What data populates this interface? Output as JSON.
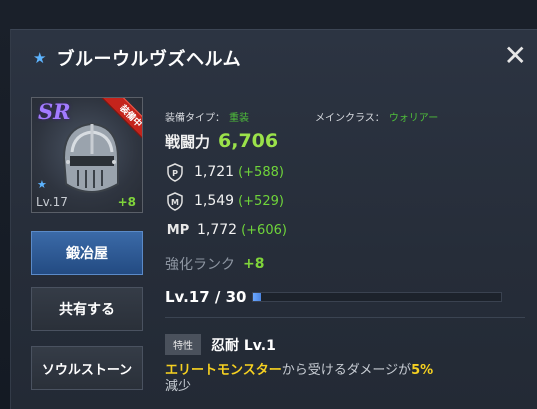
{
  "item": {
    "name": "ブルーウルヴズヘルム",
    "rarity": "SR",
    "equipped_badge": "装備中",
    "card_level": "Lv.17",
    "card_plus": "+8"
  },
  "buttons": {
    "smith": "鍛冶屋",
    "share": "共有する",
    "soulstone": "ソウルストーン"
  },
  "meta": {
    "equip_type_label": "装備タイプ：",
    "equip_type_value": "重装",
    "main_class_label": "メインクラス：",
    "main_class_value": "ウォリアー"
  },
  "power": {
    "label": "戦闘力",
    "value": "6,706"
  },
  "stats": [
    {
      "icon": "p-shield-icon",
      "value": "1,721",
      "bonus": "(+588)"
    },
    {
      "icon": "m-shield-icon",
      "value": "1,549",
      "bonus": "(+529)"
    },
    {
      "icon": "mp-icon",
      "label": "MP",
      "value": "1,772",
      "bonus": "(+606)"
    }
  ],
  "enhance": {
    "label": "強化ランク",
    "value": "+8"
  },
  "level": {
    "text": "Lv.17 / 30",
    "current": 17,
    "max": 30
  },
  "trait": {
    "tag": "特性",
    "name": "忍耐 Lv.1",
    "desc_target": "エリートモンスター",
    "desc_mid": "から受けるダメージが",
    "desc_pct": "5%",
    "desc_end": "減少"
  },
  "colors": {
    "accent_green": "#7fd43a",
    "highlight_yellow": "#f5d021",
    "rarity_purple": "#a27bff",
    "primary_blue": "#2f5a94"
  }
}
